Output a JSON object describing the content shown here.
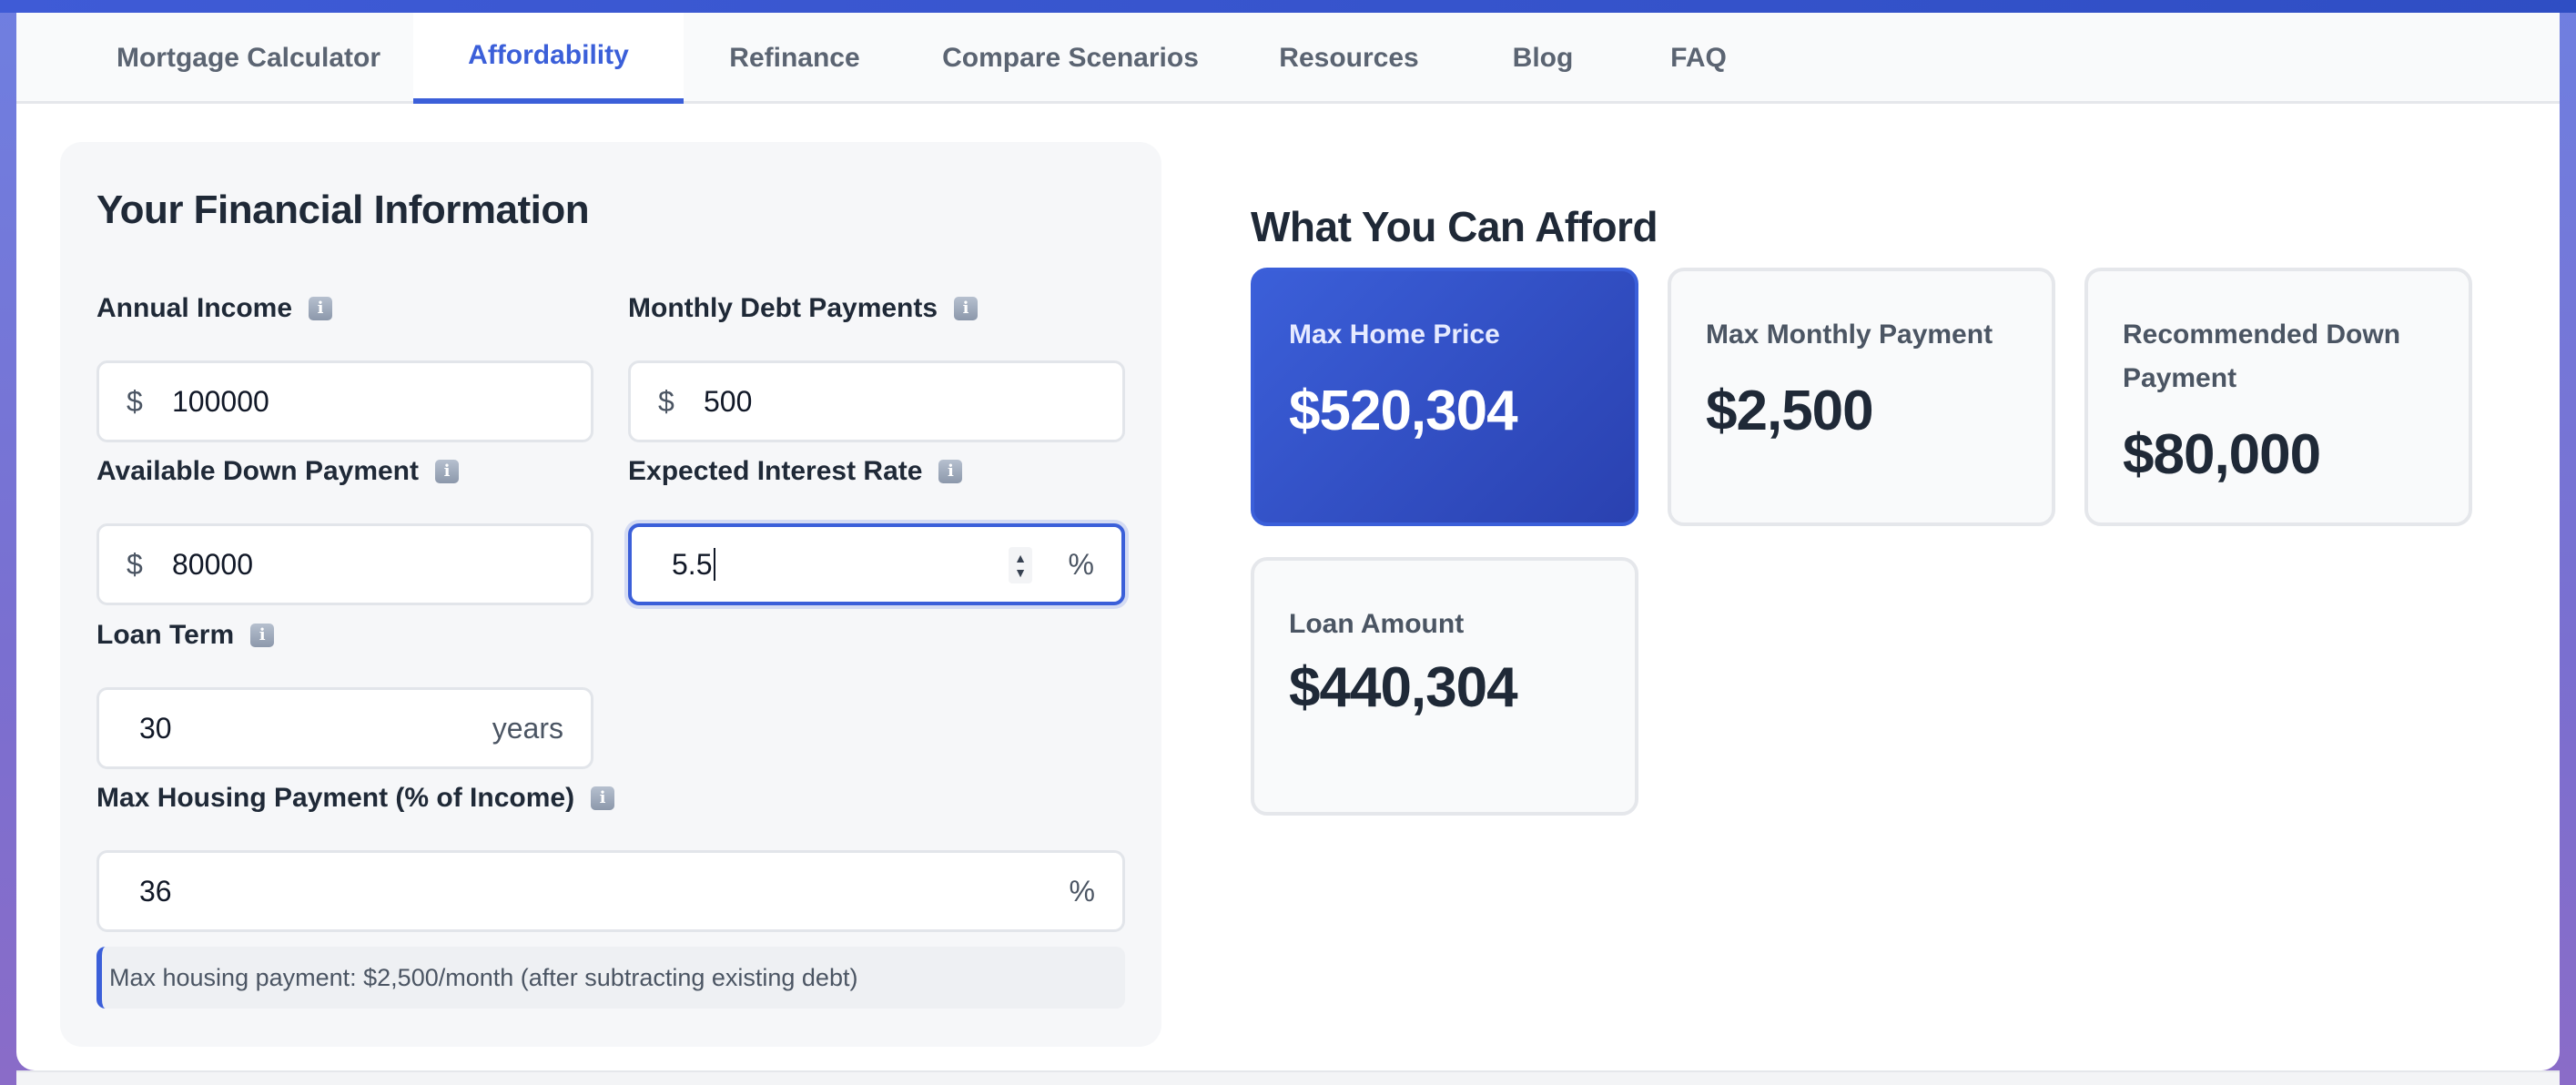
{
  "tabs": [
    {
      "label": "Mortgage Calculator",
      "active": false
    },
    {
      "label": "Affordability",
      "active": true
    },
    {
      "label": "Refinance",
      "active": false
    },
    {
      "label": "Compare Scenarios",
      "active": false
    },
    {
      "label": "Resources",
      "active": false
    },
    {
      "label": "Blog",
      "active": false
    },
    {
      "label": "FAQ",
      "active": false
    }
  ],
  "form": {
    "title": "Your Financial Information",
    "annual_income": {
      "label": "Annual Income",
      "prefix": "$",
      "value": "100000"
    },
    "monthly_debt": {
      "label": "Monthly Debt Payments",
      "prefix": "$",
      "value": "500"
    },
    "down_payment": {
      "label": "Available Down Payment",
      "prefix": "$",
      "value": "80000"
    },
    "interest_rate": {
      "label": "Expected Interest Rate",
      "value": "5.5",
      "suffix": "%"
    },
    "loan_term": {
      "label": "Loan Term",
      "value": "30",
      "suffix": "years"
    },
    "max_housing": {
      "label": "Max Housing Payment (% of Income)",
      "value": "36",
      "suffix": "%"
    },
    "info_glyph": "i",
    "spinner_up": "▲",
    "spinner_down": "▼",
    "note": "Max housing payment: $2,500/month (after subtracting existing debt)"
  },
  "results": {
    "title": "What You Can Afford",
    "max_home_price": {
      "label": "Max Home Price",
      "value": "$520,304"
    },
    "max_monthly_payment": {
      "label": "Max Monthly Payment",
      "value": "$2,500"
    },
    "recommended_down": {
      "label": "Recommended Down Payment",
      "value": "$80,000"
    },
    "loan_amount": {
      "label": "Loan Amount",
      "value": "$440,304"
    }
  },
  "colors": {
    "accent": "#3b5fd9",
    "primary_card_start": "#3b5fd9",
    "primary_card_end": "#2a41b0"
  }
}
